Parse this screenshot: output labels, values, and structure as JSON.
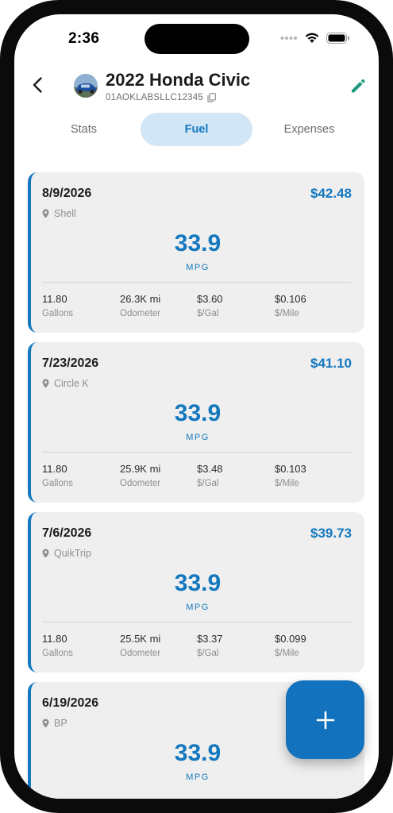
{
  "status_bar": {
    "time": "2:36"
  },
  "header": {
    "title": "2022 Honda Civic",
    "vin": "01AOKLABSLLC12345",
    "back_icon": "chevron-left-icon",
    "edit_icon": "pencil-icon",
    "copy_icon": "copy-icon"
  },
  "tabs": [
    {
      "label": "Stats",
      "active": false
    },
    {
      "label": "Fuel",
      "active": true
    },
    {
      "label": "Expenses",
      "active": false
    }
  ],
  "colors": {
    "accent": "#1478bf",
    "tab_active_bg": "#d2e6f5",
    "card_bg": "#efefef",
    "edit_icon": "#1f9a7a"
  },
  "fuel_entries": [
    {
      "date": "8/9/2026",
      "cost": "$42.48",
      "station": "Shell",
      "mpg": "33.9",
      "mpg_label": "MPG",
      "gallons": "11.80",
      "gallons_label": "Gallons",
      "odometer": "26.3K mi",
      "odometer_label": "Odometer",
      "price_per_gal": "$3.60",
      "price_per_gal_label": "$/Gal",
      "cost_per_mile": "$0.106",
      "cost_per_mile_label": "$/Mile"
    },
    {
      "date": "7/23/2026",
      "cost": "$41.10",
      "station": "Circle K",
      "mpg": "33.9",
      "mpg_label": "MPG",
      "gallons": "11.80",
      "gallons_label": "Gallons",
      "odometer": "25.9K mi",
      "odometer_label": "Odometer",
      "price_per_gal": "$3.48",
      "price_per_gal_label": "$/Gal",
      "cost_per_mile": "$0.103",
      "cost_per_mile_label": "$/Mile"
    },
    {
      "date": "7/6/2026",
      "cost": "$39.73",
      "station": "QuikTrip",
      "mpg": "33.9",
      "mpg_label": "MPG",
      "gallons": "11.80",
      "gallons_label": "Gallons",
      "odometer": "25.5K mi",
      "odometer_label": "Odometer",
      "price_per_gal": "$3.37",
      "price_per_gal_label": "$/Gal",
      "cost_per_mile": "$0.099",
      "cost_per_mile_label": "$/Mile"
    },
    {
      "date": "6/19/2026",
      "cost": "",
      "station": "BP",
      "mpg": "33.9",
      "mpg_label": "MPG"
    }
  ],
  "fab": {
    "icon": "plus-icon"
  }
}
